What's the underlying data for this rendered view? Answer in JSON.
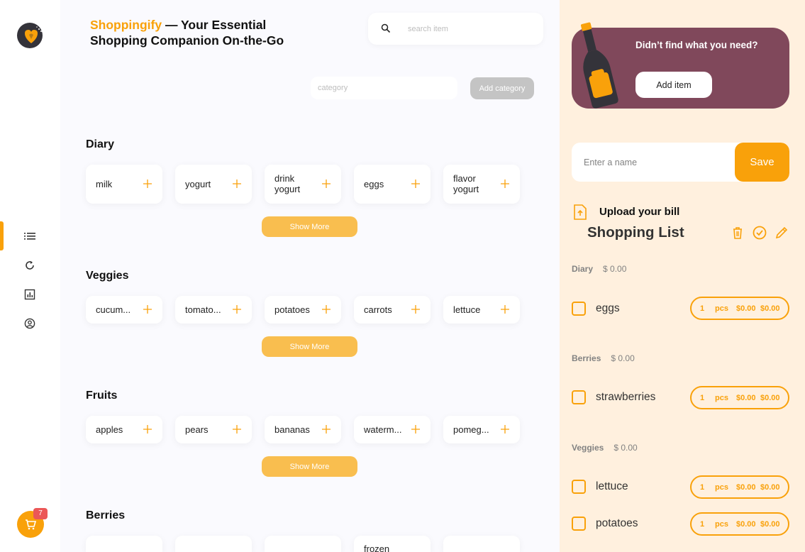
{
  "app": {
    "brand": "Shoppingify",
    "tagline": " — Your Essential Shopping Companion On-the-Go"
  },
  "search": {
    "placeholder": "search item"
  },
  "category_form": {
    "placeholder": "category",
    "button": "Add category"
  },
  "categories": [
    {
      "name": "Diary",
      "items": [
        "milk",
        "yogurt",
        "drink yogurt",
        "eggs",
        "flavor yogurt"
      ],
      "show_more": "Show More"
    },
    {
      "name": "Veggies",
      "items": [
        "cucum...",
        "tomato...",
        "potatoes",
        "carrots",
        "lettuce"
      ],
      "show_more": "Show More"
    },
    {
      "name": "Fruits",
      "items": [
        "apples",
        "pears",
        "bananas",
        "waterm...",
        "pomeg..."
      ],
      "show_more": "Show More"
    },
    {
      "name": "Berries",
      "items": [
        "",
        "",
        "",
        "frozen",
        ""
      ]
    }
  ],
  "sidebar": {
    "nav": [
      "list-icon",
      "refresh-icon",
      "chart-icon",
      "user-icon"
    ],
    "cart_count": "7"
  },
  "panel": {
    "promo_text": "Didn’t find what you need?",
    "promo_button": "Add item",
    "name_placeholder": "Enter a name",
    "save_label": "Save",
    "upload_label": "Upload your bill",
    "list_title": "Shopping List",
    "groups": [
      {
        "name": "Diary",
        "amount": "$ 0.00",
        "items": [
          {
            "name": "eggs",
            "qty": "1",
            "unit": "pcs",
            "price": "$0.00",
            "total": "$0.00"
          }
        ]
      },
      {
        "name": "Berries",
        "amount": "$ 0.00",
        "items": [
          {
            "name": "strawberries",
            "qty": "1",
            "unit": "pcs",
            "price": "$0.00",
            "total": "$0.00"
          }
        ]
      },
      {
        "name": "Veggies",
        "amount": "$ 0.00",
        "items": [
          {
            "name": "lettuce",
            "qty": "1",
            "unit": "pcs",
            "price": "$0.00",
            "total": "$0.00"
          },
          {
            "name": "potatoes",
            "qty": "1",
            "unit": "pcs",
            "price": "$0.00",
            "total": "$0.00"
          }
        ]
      }
    ]
  },
  "colors": {
    "accent": "#f9a10a",
    "promo_bg": "#80485b",
    "panel_bg": "#fff0de",
    "main_bg": "#fafafe"
  }
}
